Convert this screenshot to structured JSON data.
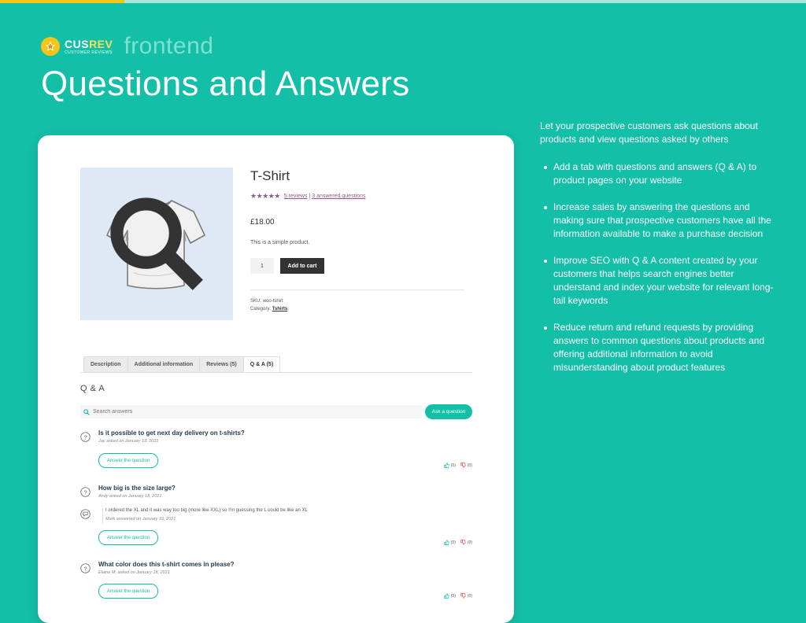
{
  "brand": {
    "name_prefix": "CUS",
    "name_suffix": "REV",
    "subtitle": "CUSTOMER REVIEWS",
    "tag": "frontend"
  },
  "page_title": "Questions and Answers",
  "intro": "Let your prospective customers ask questions about products and view questions asked by others",
  "features": [
    "Add a tab with questions and answers (Q & A) to product pages on your website",
    "Increase sales by answering the questions and making sure that prospective customers have all the information available to make a purchase decision",
    "Improve SEO with Q & A content created by your customers that helps search engines better understand and index your website for relevant long-tail keywords",
    "Reduce return and refund requests by providing answers to common questions about products and offering additional information to avoid misunderstanding about product features"
  ],
  "product": {
    "title": "T-Shirt",
    "stars": "★★★★★",
    "reviews_link": "5 reviews",
    "separator": "|",
    "answered_link": "3 answered questions",
    "price": "£18.00",
    "short_description": "This is a simple product.",
    "quantity": "1",
    "add_to_cart": "Add to cart",
    "sku_label": "SKU:",
    "sku": "woo-tshirt",
    "category_label": "Category:",
    "category": "Tshirts"
  },
  "tabs": [
    {
      "label": "Description"
    },
    {
      "label": "Additional information"
    },
    {
      "label": "Reviews (5)"
    },
    {
      "label": "Q & A (5)"
    }
  ],
  "qa": {
    "heading": "Q & A",
    "search_placeholder": "Search answers",
    "ask_button": "Ask a question",
    "answer_button": "Answer the question",
    "items": [
      {
        "question": "Is it possible to get next day delivery on t-shirts?",
        "meta": "Jay asked on January 19, 2021",
        "upvotes": "(0)",
        "downvotes": "(0)"
      },
      {
        "question": "How big is the size large?",
        "meta": "Andy asked on January 18, 2021",
        "answer": "I ordered the XL and it was way too big (more like XXL) so I'm guessing the L could be like an XL",
        "answer_meta": "Mark answered on January 19, 2021",
        "upvotes": "(0)",
        "downvotes": "(0)"
      },
      {
        "question": "What color does this t-shirt comes in please?",
        "meta": "Elaine M. asked on January 18, 2021",
        "upvotes": "(0)",
        "downvotes": "(0)"
      }
    ]
  },
  "colors": {
    "background": "#13bfa6",
    "accent_yellow": "#f5c518",
    "star_purple": "#96588a"
  }
}
